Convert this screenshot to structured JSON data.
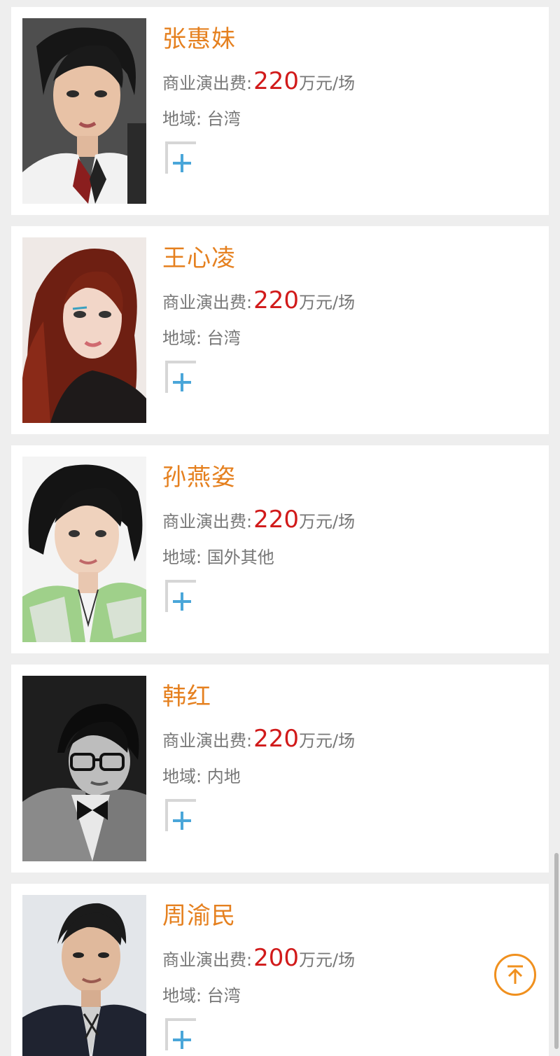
{
  "fee_label": "商业演出费:",
  "fee_unit": "万元/场",
  "region_label": "地域:",
  "colors": {
    "name": "#e5801f",
    "price": "#d11a1a",
    "label": "#777777",
    "add_icon": "#4aa6d9",
    "back_to_top": "#f0901e"
  },
  "artists": [
    {
      "name": "张惠妹",
      "price": "220",
      "region": "台湾",
      "photo": "portrait-short-dark-hair-white-collar"
    },
    {
      "name": "王心凌",
      "price": "220",
      "region": "台湾",
      "photo": "portrait-long-auburn-hair"
    },
    {
      "name": "孙燕姿",
      "price": "220",
      "region": "国外其他",
      "photo": "portrait-short-hair-green-shirt"
    },
    {
      "name": "韩红",
      "price": "220",
      "region": "内地",
      "photo": "portrait-glasses-bowtie-bw"
    },
    {
      "name": "周渝民",
      "price": "200",
      "region": "台湾",
      "photo": "portrait-man-dark-suit"
    }
  ],
  "back_to_top_icon": "arrow-up-to-top-icon",
  "add_icon": "add-plus-icon"
}
